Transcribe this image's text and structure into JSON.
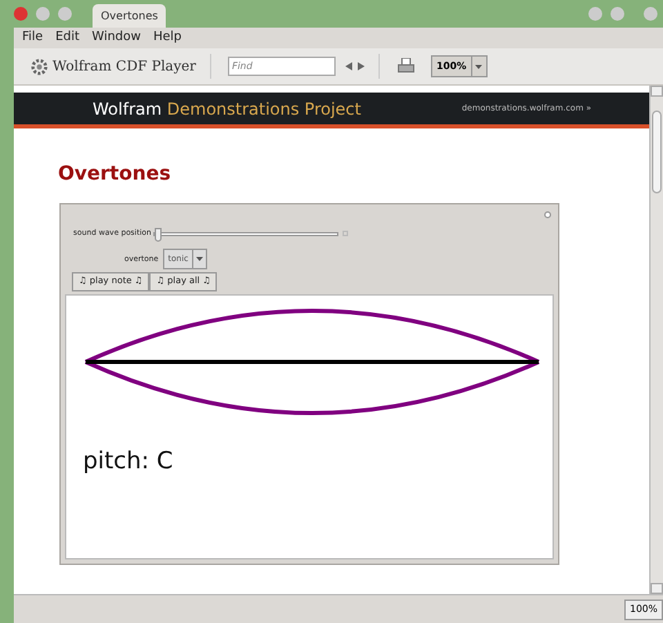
{
  "window": {
    "tab_title": "Overtones"
  },
  "menu": [
    "File",
    "Edit",
    "Window",
    "Help"
  ],
  "toolbar": {
    "app_name": "Wolfram CDF Player",
    "search": {
      "placeholder": "Find"
    },
    "zoom": "100%"
  },
  "banner": {
    "title_main": "Wolfram",
    "title_accent": "Demonstrations Project",
    "link": "demonstrations.wolfram.com »"
  },
  "page_title": "Overtones",
  "controls": {
    "slider": {
      "label": "sound wave position",
      "level": 0
    },
    "overtone": {
      "label": "overtone",
      "value": "tonic"
    },
    "buttons": [
      "♫ play note ♫",
      "♫ play all ♫"
    ]
  },
  "plot": {
    "pitch": "pitch: C"
  },
  "status_bar": {
    "zoom": "100%"
  }
}
